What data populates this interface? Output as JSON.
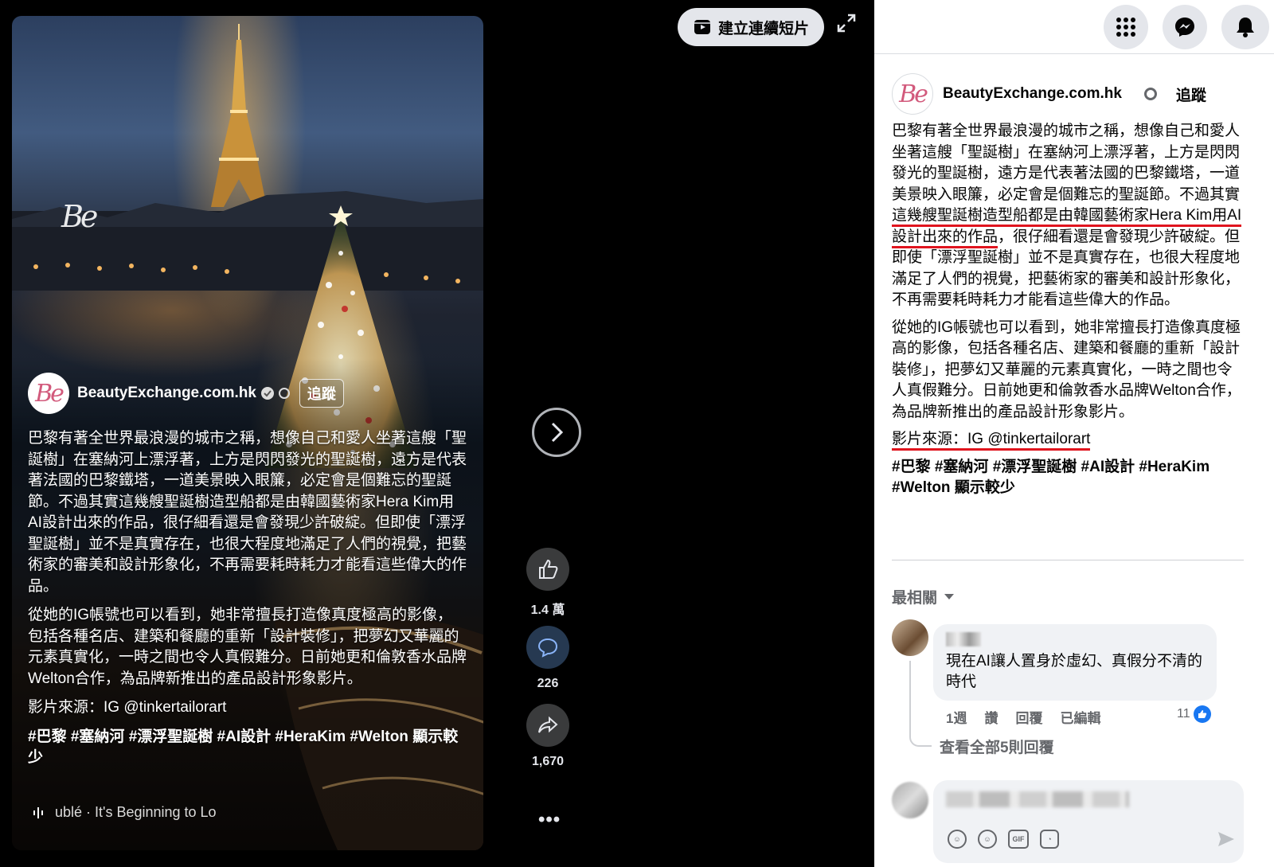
{
  "viewer": {
    "watermark": "Be",
    "create_reel_label": "建立連續短片",
    "author_name": "BeautyExchange.com.hk",
    "author_avatar_text": "Be",
    "follow_label": "追蹤",
    "caption_p1": "巴黎有著全世界最浪漫的城市之稱，想像自己和愛人坐著這艘「聖誕樹」在塞納河上漂浮著，上方是閃閃發光的聖誕樹，遠方是代表著法國的巴黎鐵塔，一道美景映入眼簾，必定會是個難忘的聖誕節。不過其實這幾艘聖誕樹造型船都是由韓國藝術家Hera Kim用AI設計出來的作品，很仔細看還是會發現少許破綻。但即使「漂浮聖誕樹」並不是真實存在，也很大程度地滿足了人們的視覺，把藝術家的審美和設計形象化，不再需要耗時耗力才能看這些偉大的作品。",
    "caption_p2": "從她的IG帳號也可以看到，她非常擅長打造像真度極高的影像，包括各種名店、建築和餐廳的重新「設計裝修」，把夢幻又華麗的元素真實化，一時之間也令人真假難分。日前她更和倫敦香水品牌Welton合作，為品牌新推出的產品設計形象影片。",
    "caption_source": "影片來源：IG @tinkertailorart",
    "caption_tags": "#巴黎 #塞納河 #漂浮聖誕樹 #AI設計 #HeraKim #Welton 顯示較少",
    "music": "ublé · It's Beginning to Lo",
    "likes": "1.4 萬",
    "comments": "226",
    "shares": "1,670",
    "more": "•••"
  },
  "panel": {
    "author_name": "BeautyExchange.com.hk",
    "author_avatar_text": "Be",
    "follow_label": "追蹤",
    "body_p1_a": "巴黎有著全世界最浪漫的城市之稱，想像自己和愛人坐著這艘「聖誕樹」在塞納河上漂浮著，上方是閃閃發光的聖誕樹，遠方是代表著法國的巴黎鐵塔，一道美景映入眼簾，必定會是個難忘的聖誕節。不過其實",
    "body_p1_highlight": "這幾艘聖誕樹造型船都是由韓國藝術家Hera Kim用AI設計出來的作品",
    "body_p1_b": "，很仔細看還是會發現少許破綻。但即使「漂浮聖誕樹」並不是真實存在，也很大程度地滿足了人們的視覺，把藝術家的審美和設計形象化，不再需要耗時耗力才能看這些偉大的作品。",
    "body_p2": "從她的IG帳號也可以看到，她非常擅長打造像真度極高的影像，包括各種名店、建築和餐廳的重新「設計裝修」，把夢幻又華麗的元素真實化，一時之間也令人真假難分。日前她更和倫敦香水品牌Welton合作，為品牌新推出的產品設計形象影片。",
    "source": "影片來源：IG @tinkertailorart",
    "tags": "#巴黎 #塞納河 #漂浮聖誕樹 #AI設計 #HeraKim #Welton 顯示較少",
    "sort_label": "最相關",
    "comment": {
      "text": "現在AI讓人置身於虛幻、真假分不清的時代",
      "time": "1週",
      "like": "讚",
      "reply": "回覆",
      "edited": "已編輯",
      "reactions": "11"
    },
    "view_replies": "查看全部5則回覆",
    "composer_icons": {
      "gif": "GIF"
    }
  },
  "colors": {
    "accent_blue": "#1877f2",
    "underline_red": "#e0141e",
    "panel_bg": "#ffffff",
    "brand_pink": "#d25a7c"
  }
}
